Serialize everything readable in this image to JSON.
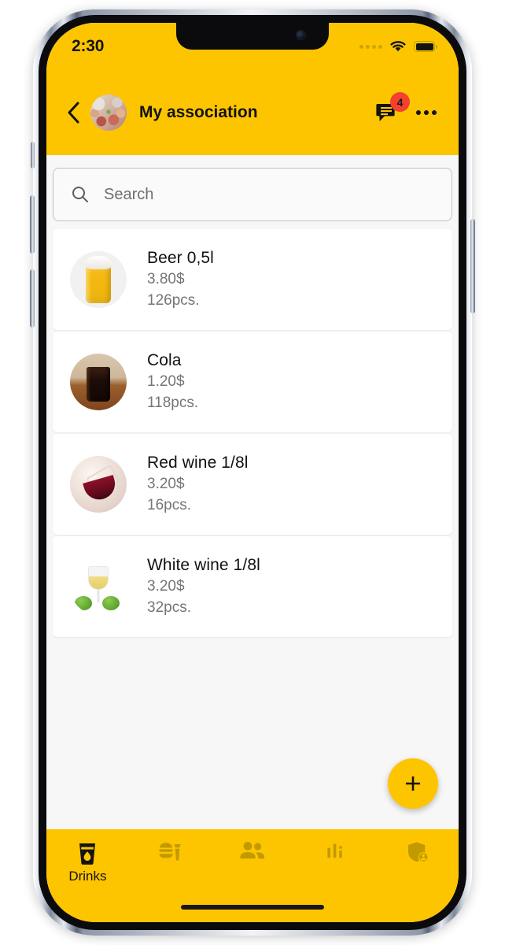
{
  "status_bar": {
    "time": "2:30",
    "signal_icon": "signal-dots-icon",
    "wifi_icon": "wifi-icon",
    "battery_icon": "battery-full-icon"
  },
  "header": {
    "back_icon": "chevron-left-icon",
    "avatar": "group-avatar-photo",
    "title": "My association",
    "chat_icon": "chat-bubble-icon",
    "chat_badge_count": "4",
    "more_icon": "more-horizontal-icon"
  },
  "search": {
    "placeholder": "Search",
    "value": "",
    "icon": "search-icon"
  },
  "drinks_list": [
    {
      "name": "Beer 0,5l",
      "price": "3.80$",
      "quantity": "126pcs.",
      "thumb": "beer-glass-thumbnail"
    },
    {
      "name": "Cola",
      "price": "1.20$",
      "quantity": "118pcs.",
      "thumb": "cola-glass-thumbnail"
    },
    {
      "name": "Red wine 1/8l",
      "price": "3.20$",
      "quantity": "16pcs.",
      "thumb": "red-wine-glass-thumbnail"
    },
    {
      "name": "White wine 1/8l",
      "price": "3.20$",
      "quantity": "32pcs.",
      "thumb": "white-wine-glass-thumbnail"
    }
  ],
  "fab": {
    "icon": "plus-icon",
    "label": "+"
  },
  "bottom_nav": {
    "items": [
      {
        "icon": "drink-cup-icon",
        "label": "Drinks",
        "active": true
      },
      {
        "icon": "fast-food-icon",
        "label": "",
        "active": false
      },
      {
        "icon": "people-icon",
        "label": "",
        "active": false
      },
      {
        "icon": "bar-chart-icon",
        "label": "",
        "active": false
      },
      {
        "icon": "shield-user-icon",
        "label": "",
        "active": false
      }
    ]
  },
  "colors": {
    "brand_yellow": "#FDC500",
    "badge_red": "#F4402E",
    "page_bg": "#F7F7F7",
    "card_bg": "#FFFFFF",
    "text_primary": "#111111",
    "text_secondary": "#757575",
    "nav_inactive": "#C29A00"
  }
}
